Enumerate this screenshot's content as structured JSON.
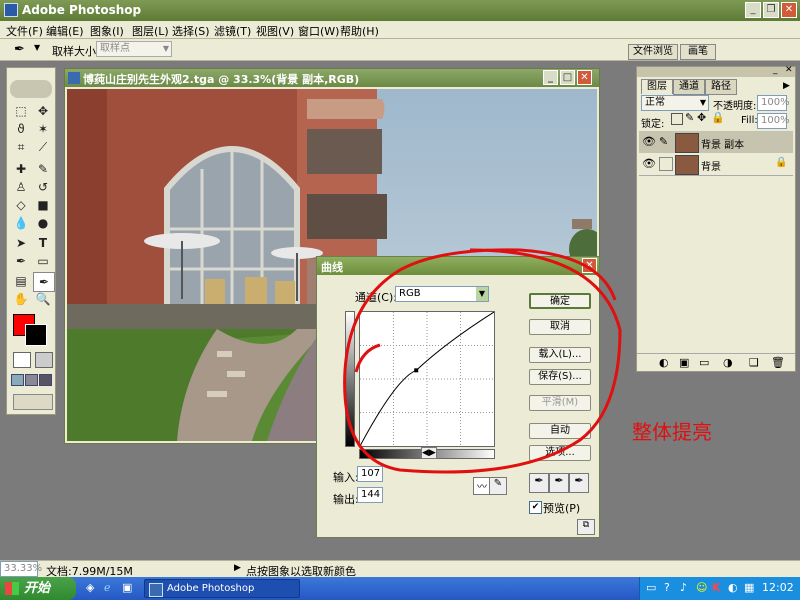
{
  "app": {
    "title": "Adobe Photoshop"
  },
  "menu": [
    "文件(F)",
    "编辑(E)",
    "图象(I)",
    "图层(L)",
    "选择(S)",
    "滤镜(T)",
    "视图(V)",
    "窗口(W)",
    "帮助(H)"
  ],
  "options": {
    "sample_size_label": "取样大小:",
    "sample_size_value": "取样点",
    "palette_tabs": [
      "文件浏览",
      "画笔"
    ]
  },
  "document": {
    "title": "博莼山庄别先生外观2.tga @ 33.3%(背景 副本,RGB)"
  },
  "layers_panel": {
    "tabs": [
      "图层",
      "通道",
      "路径"
    ],
    "blend_mode": "正常",
    "opacity_label": "不透明度:",
    "opacity_value": "100%",
    "lock_label": "锁定:",
    "fill_label": "Fill:",
    "fill_value": "100%",
    "layers": [
      {
        "name": "背景 副本",
        "selected": true
      },
      {
        "name": "背景",
        "selected": false
      }
    ]
  },
  "curves": {
    "title": "曲线",
    "channel_label": "通道(C):",
    "channel_value": "RGB",
    "input_label": "输入:",
    "input_value": "107",
    "output_label": "输出:",
    "output_value": "144",
    "buttons": {
      "ok": "确定",
      "cancel": "取消",
      "load": "载入(L)...",
      "save": "保存(S)...",
      "smooth": "平滑(M)",
      "auto": "自动",
      "options": "选项..."
    },
    "preview_label": "预览(P)",
    "preview_checked": true,
    "curve_points": [
      [
        0,
        0
      ],
      [
        107,
        144
      ],
      [
        255,
        255
      ]
    ]
  },
  "annotation": "整体提亮",
  "status": {
    "zoom": "33.33%",
    "doc_size": "文档:7.99M/15M",
    "hint": "点按图象以选取新颜色"
  },
  "taskbar": {
    "start": "开始",
    "task": "Adobe Photoshop",
    "clock": "12:02"
  },
  "colors": {
    "foreground": "#ff0000",
    "background": "#000000",
    "annotation": "#e01010"
  }
}
